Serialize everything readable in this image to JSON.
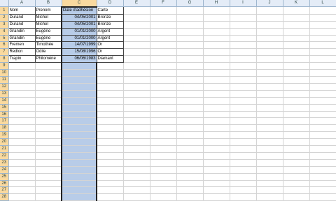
{
  "columns": [
    "A",
    "B",
    "C",
    "D",
    "E",
    "F",
    "G",
    "H",
    "I",
    "J",
    "K",
    "L"
  ],
  "rows": [
    [
      "Nom",
      "Prenom",
      "Date d'adhésion",
      "Carte"
    ],
    [
      "Durand",
      "Michel",
      "04/05/2001",
      "Bronze"
    ],
    [
      "Durand",
      "Michel",
      "04/05/2001",
      "Bronze"
    ],
    [
      "Grandin",
      "Eugène",
      "01/01/2000",
      "Argent"
    ],
    [
      "Grandin",
      "Eugène",
      "01/01/2000",
      "Argent"
    ],
    [
      "Fremen",
      "Timothée",
      "14/07/1999",
      "Or"
    ],
    [
      "Redlon",
      "Odile",
      "15/08/1996",
      "Or"
    ],
    [
      "Trapin",
      "Philomène",
      "06/06/1983",
      "Diamant"
    ]
  ],
  "total_rows": 28,
  "selected_column": "C"
}
